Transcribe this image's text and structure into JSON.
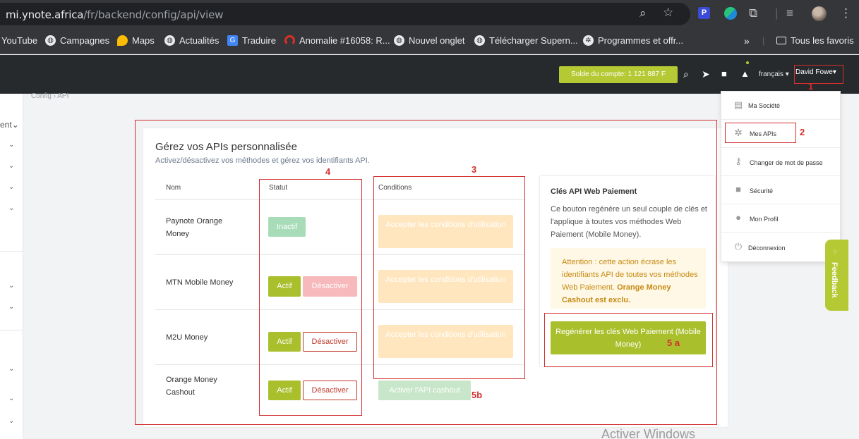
{
  "browser": {
    "url_host": "mi.ynote.africa",
    "url_path": "/fr/backend/config/api/view",
    "bookmarks": [
      "YouTube",
      "Campagnes",
      "Maps",
      "Actualités",
      "Traduire",
      "Anomalie #16058: R...",
      "Nouvel onglet",
      "Télécharger Supern...",
      "Programmes et offr..."
    ],
    "all_bookmarks": "Tous les favoris",
    "ext_letter": "P"
  },
  "header": {
    "balance": "Solde du compte: 1 121 887 F",
    "language": "français",
    "user": "David Fowe"
  },
  "sidebar": {
    "partial_label": "ent"
  },
  "breadcrumb": {
    "root": "Config",
    "sep": "›",
    "current": "API"
  },
  "main": {
    "title": "Gérez vos APIs personnalisée",
    "subtitle": "Activez/désactivez vos méthodes et gérez vos identifiants API.",
    "columns": [
      "Nom",
      "Statut",
      "Conditions"
    ],
    "rows": [
      {
        "name": "Paynote Orange Money",
        "status": "Inactif",
        "condition": "Accepter les conditions d'utilisation"
      },
      {
        "name": "MTN Mobile Money",
        "status": "Actif",
        "deactivate": "Désactiver",
        "condition": "Accepter les conditions d'utilisation"
      },
      {
        "name": "M2U Money",
        "status": "Actif",
        "deactivate": "Désactiver",
        "condition": "Accepter les conditions d'utilisation"
      },
      {
        "name": "Orange Money Cashout",
        "status": "Actif",
        "deactivate": "Désactiver",
        "cashout": "Activer l'API cashout"
      }
    ]
  },
  "panel": {
    "title": "Clés API Web Paiement",
    "description": "Ce bouton regénère un seul couple de clés et l'applique à toutes vos méthodes Web Paiement (Mobile Money).",
    "warning": "Attention : cette action écrase les identifiants API de toutes vos méthodes Web Paiement.",
    "warning_bold": "Orange Money Cashout est exclu.",
    "regen_button": "Regénérer les clés Web Paiement (Mobile Money)"
  },
  "dropdown": {
    "items": [
      "Ma Société",
      "Mes APIs",
      "Changer de mot de passe",
      "Sécurité",
      "Mon Profil",
      "Déconnexion"
    ]
  },
  "feedback": "Feedback",
  "annotations": [
    "1",
    "2",
    "3",
    "4",
    "5 a",
    "5b"
  ],
  "watermark": "Activer Windows",
  "colors": {
    "accent": "#b5c934",
    "annotation": "#d32f2f"
  }
}
